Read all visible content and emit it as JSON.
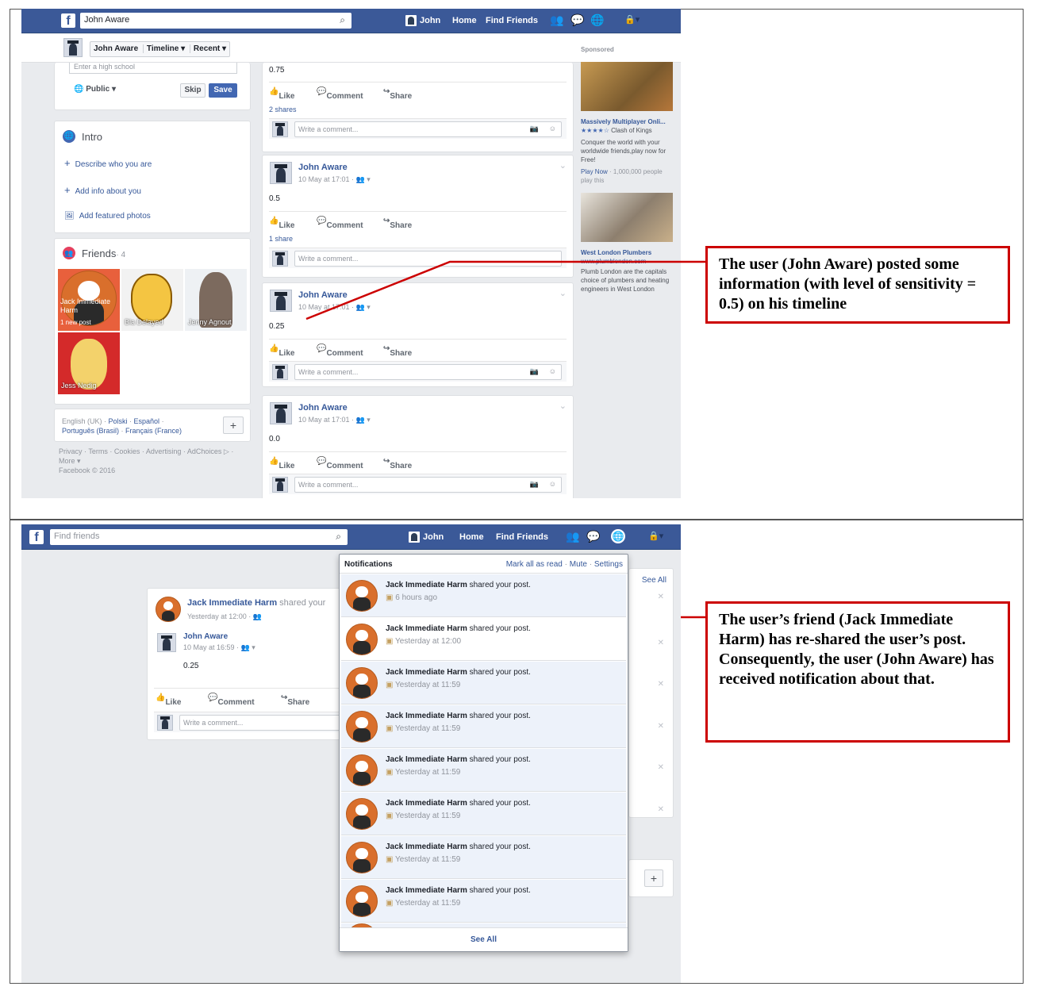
{
  "top": {
    "search_value": "John Aware",
    "nav": {
      "user": "John",
      "home": "Home",
      "find_friends": "Find Friends"
    },
    "subnav": {
      "name": "John Aware",
      "timeline": "Timeline",
      "recent": "Recent"
    },
    "high_school_placeholder": "Enter a high school",
    "privacy": "Public",
    "skip": "Skip",
    "save": "Save",
    "intro": {
      "title": "Intro",
      "items": [
        "Describe who you are",
        "Add info about you",
        "Add featured photos"
      ]
    },
    "friends": {
      "title": "Friends",
      "count": "· 4",
      "list": [
        {
          "name": "Jack Immediate Harm",
          "sub": "1 new post"
        },
        {
          "name": "Bla Delayed",
          "sub": ""
        },
        {
          "name": "Jenny Agnout",
          "sub": ""
        },
        {
          "name": "Jess Nedig",
          "sub": ""
        }
      ]
    },
    "languages": {
      "line1": "English (UK) · ",
      "l1a": "Polski",
      "l1b": "Español",
      "line2a": "Português (Brasil)",
      "line2b": "Français (France)"
    },
    "footer": {
      "line1": "Privacy · Terms · Cookies · Advertising · AdChoices ▷ ·",
      "line2": "More ▾",
      "line3": "Facebook © 2016"
    },
    "first_post_value": "0.75",
    "actions": {
      "like": "Like",
      "comment": "Comment",
      "share": "Share"
    },
    "first_shares": "2 shares",
    "comment_placeholder": "Write a comment...",
    "posts": [
      {
        "author": "John Aware",
        "meta": "10 May at 17:01 · 👥 ▾",
        "value": "0.5",
        "shares": "1 share"
      },
      {
        "author": "John Aware",
        "meta": "10 May at 17:01 · 👥 ▾",
        "value": "0.25",
        "shares": ""
      },
      {
        "author": "John Aware",
        "meta": "10 May at 17:01 · 👥 ▾",
        "value": "0.0",
        "shares": ""
      }
    ],
    "sponsored": {
      "label": "Sponsored",
      "ad1": {
        "title": "Massively Multiplayer Onli...",
        "stars": "★★★★☆",
        "game": "Clash of Kings",
        "body": "Conquer the world with your worldwide friends,play now for Free!",
        "cta": "Play Now",
        "cta_meta": " · 1,000,000 people play this"
      },
      "ad2": {
        "title": "West London Plumbers",
        "url": "www.plumblondon.com",
        "body": "Plumb London are the capitals choice of plumbers and heating engineers in West London"
      }
    },
    "annotation": "The user (John Aware) posted some information (with level of sensitivity = 0.5) on his timeline"
  },
  "bottom": {
    "search_placeholder": "Find friends",
    "nav": {
      "user": "John",
      "home": "Home",
      "find_friends": "Find Friends"
    },
    "post": {
      "sharer": "Jack Immediate Harm",
      "shared_text": " shared your",
      "meta": "Yesterday at 12:00 · 👥",
      "inner_author": "John Aware",
      "inner_meta": "10 May at 16:59 · 👥 ▾",
      "value": "0.25",
      "like": "Like",
      "comment": "Comment",
      "share": "Share",
      "comment_placeholder": "Write a comment..."
    },
    "right_see_all": "See All",
    "notifications": {
      "title": "Notifications",
      "mark_all": "Mark all as read",
      "mute": "Mute",
      "settings": "Settings",
      "items": [
        {
          "who": "Jack Immediate Harm",
          "what": " shared your post.",
          "when": "6 hours ago"
        },
        {
          "who": "Jack Immediate Harm",
          "what": " shared your post.",
          "when": "Yesterday at 12:00"
        },
        {
          "who": "Jack Immediate Harm",
          "what": " shared your post.",
          "when": "Yesterday at 11:59"
        },
        {
          "who": "Jack Immediate Harm",
          "what": " shared your post.",
          "when": "Yesterday at 11:59"
        },
        {
          "who": "Jack Immediate Harm",
          "what": " shared your post.",
          "when": "Yesterday at 11:59"
        },
        {
          "who": "Jack Immediate Harm",
          "what": " shared your post.",
          "when": "Yesterday at 11:59"
        },
        {
          "who": "Jack Immediate Harm",
          "what": " shared your post.",
          "when": "Yesterday at 11:59"
        },
        {
          "who": "Jack Immediate Harm",
          "what": " shared your post.",
          "when": "Yesterday at 11:59"
        }
      ],
      "see_all": "See All"
    },
    "annotation": "The user’s friend (Jack Immediate Harm) has re-shared the user’s post.\nConsequently, the user (John Aware) has received notification about that."
  }
}
